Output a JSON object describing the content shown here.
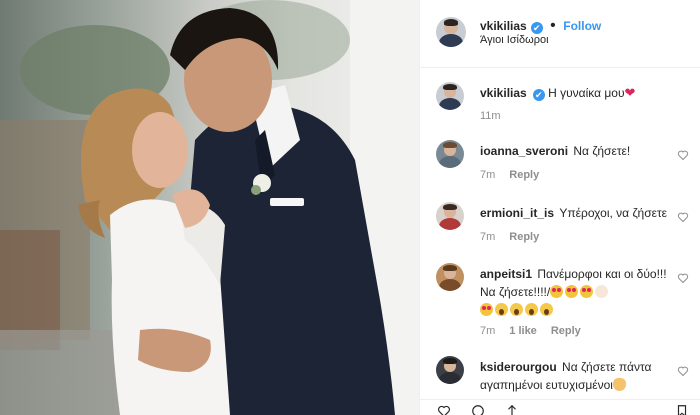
{
  "post": {
    "username": "vkikilias",
    "verified_mark": "✔",
    "separator": "•",
    "follow_label": "Follow",
    "location": "Άγιοι Ισίδωροι"
  },
  "caption": {
    "username": "vkikilias",
    "verified_mark": "✔",
    "text": "Η γυναίκα μου",
    "heart": "❤",
    "time": "11m"
  },
  "comments": [
    {
      "username": "ioanna_sveroni",
      "text": "Να ζήσετε!",
      "time": "7m",
      "reply_label": "Reply"
    },
    {
      "username": "ermioni_it_is",
      "text": "Υπέροχοι, να ζήσετε",
      "time": "7m",
      "reply_label": "Reply"
    },
    {
      "username": "anpeitsi1",
      "text": "Πανέμορφοι και οι δύο!!! Να ζήσετε!!!!/",
      "time": "7m",
      "likes": "1 like",
      "reply_label": "Reply"
    },
    {
      "username": "ksiderourgou",
      "text": "Να ζήσετε πάντα αγαπημένοι ευτυχισμένοι"
    }
  ],
  "icons": {
    "verified": "verified-badge-icon",
    "like": "heart-outline-icon",
    "comment": "comment-bubble-icon",
    "share": "share-arrow-icon",
    "save": "bookmark-icon"
  },
  "colors": {
    "link_blue": "#3897f0",
    "meta_gray": "#8e8e8e",
    "text_dark": "#262626",
    "heart_red": "#e0245e"
  }
}
